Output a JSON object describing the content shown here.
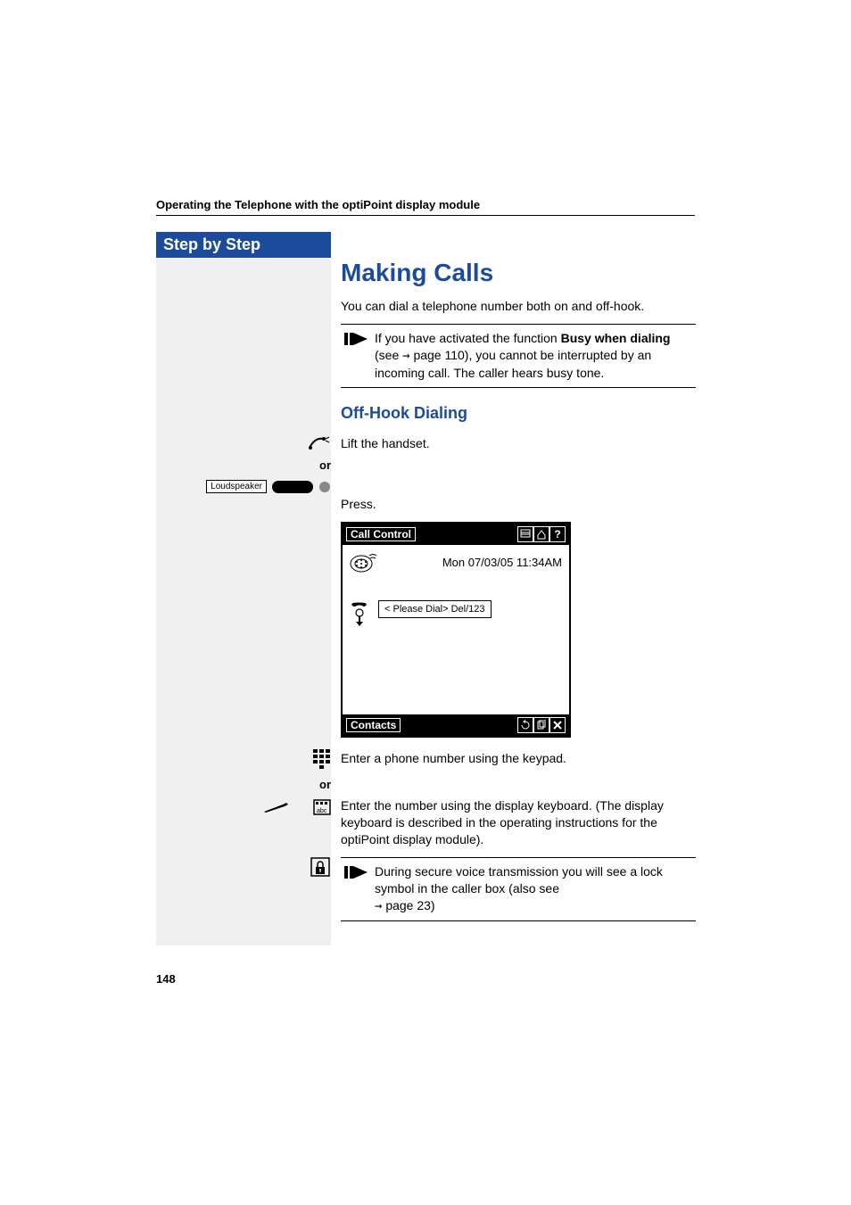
{
  "header": "Operating the Telephone with the optiPoint display module",
  "sidebar": {
    "title": "Step by Step"
  },
  "main": {
    "h1": "Making Calls",
    "intro": "You can dial a telephone number both on and off-hook.",
    "note1_pre": "If you have activated the function ",
    "note1_bold": "Busy when dialing",
    "note1_post1": " (see ",
    "note1_pageref": " page 110), you cannot be interrupted by an incoming call. The caller hears busy tone.",
    "h2": "Off-Hook Dialing",
    "text_lift": "Lift the handset.",
    "or1": "or",
    "loudspeaker_label": "Loudspeaker",
    "text_press": "Press.",
    "display": {
      "title": "Call Control",
      "timestamp": "Mon 07/03/05 11:34AM",
      "dialtext": "< Please Dial>  Del/123",
      "contacts": "Contacts"
    },
    "text_keypad": "Enter a phone number using the keypad.",
    "or2": "or",
    "text_displaykb": "Enter the number using the display keyboard. (The display keyboard is described in the operating instructions for the optiPoint display module).",
    "note2_text": "During secure voice transmission you will see a lock symbol in the caller box (also see ",
    "note2_pageref": " page 23)"
  },
  "page_number": "148"
}
